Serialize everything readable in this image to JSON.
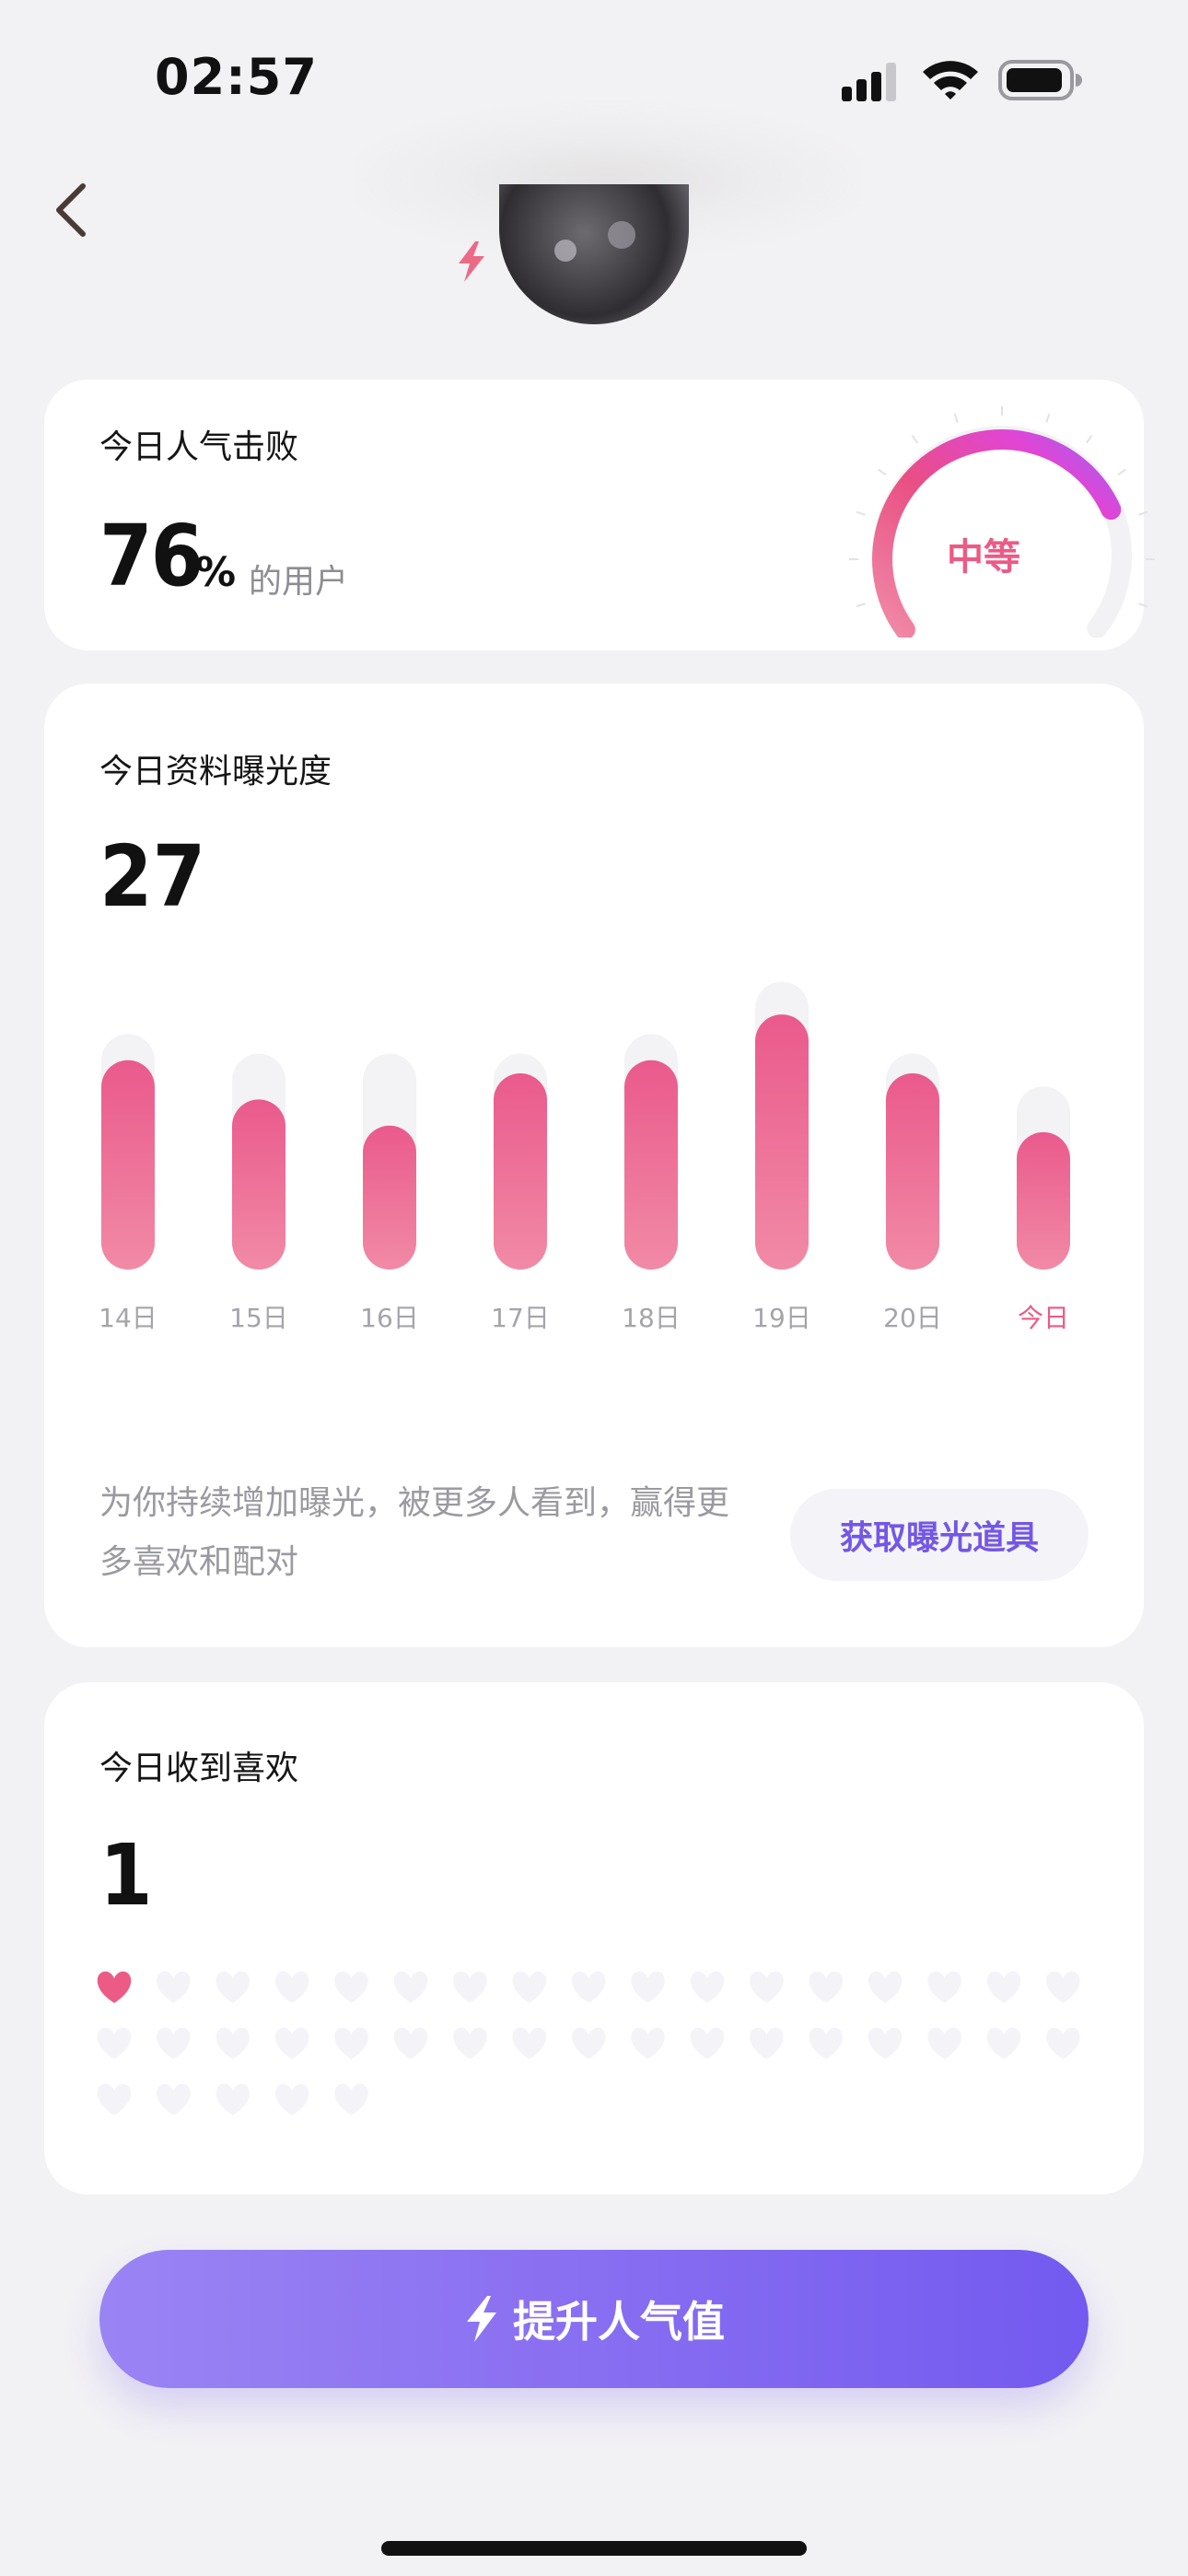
{
  "status_bar": {
    "time": "02:57"
  },
  "colors": {
    "accent_pink": "#ec5a86",
    "accent_purple": "#7357e6",
    "bar_track": "#f3f2f4"
  },
  "card_defeat": {
    "title": "今日人气击败",
    "value": "76",
    "unit": "%",
    "suffix": "的用户",
    "gauge_label": "中等",
    "gauge_level": 0.76
  },
  "card_exposure": {
    "title": "今日资料曝光度",
    "value": "27",
    "chart_data": {
      "type": "bar",
      "categories": [
        "14日",
        "15日",
        "16日",
        "17日",
        "18日",
        "19日",
        "20日",
        "今日"
      ],
      "values": [
        32,
        26,
        22,
        30,
        32,
        39,
        30,
        21
      ],
      "track_values": [
        36,
        33,
        33,
        33,
        36,
        44,
        33,
        28
      ],
      "highlight_category": "今日"
    },
    "description": "为你持续增加曝光，被更多人看到，赢得更多喜欢和配对",
    "tool_button": "获取曝光道具"
  },
  "card_likes": {
    "title": "今日收到喜欢",
    "value": "1",
    "hearts_total": 39,
    "hearts_filled": 1
  },
  "boost_button": {
    "label": "提升人气值",
    "icon": "lightning-icon"
  }
}
